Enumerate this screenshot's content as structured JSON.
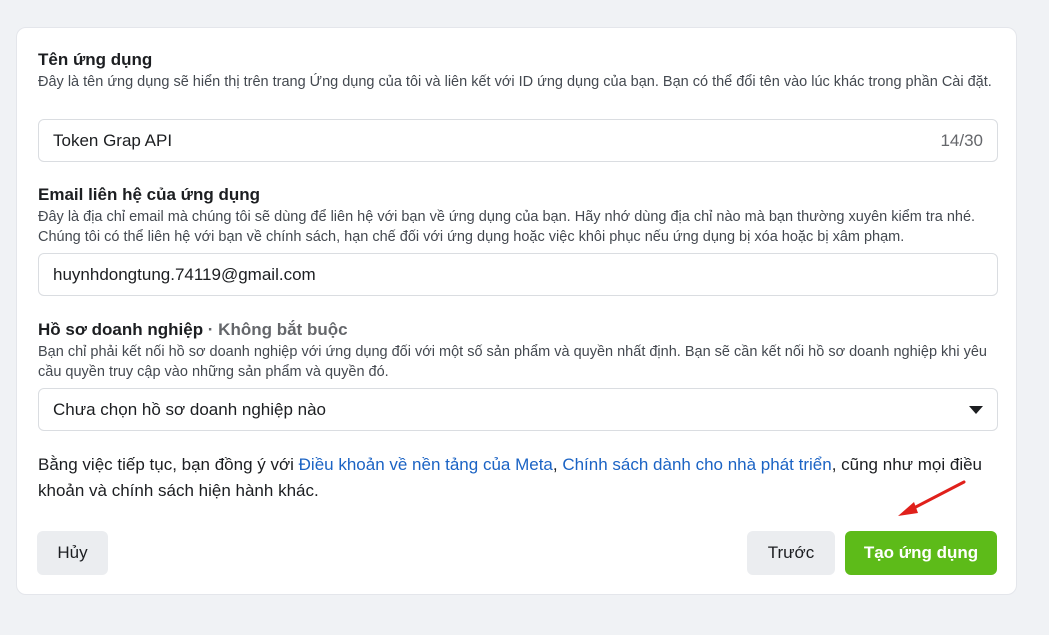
{
  "app_name": {
    "label": "Tên ứng dụng",
    "description": "Đây là tên ứng dụng sẽ hiển thị trên trang Ứng dụng của tôi và liên kết với ID ứng dụng của bạn. Bạn có thể đổi tên vào lúc khác trong phần Cài đặt.",
    "value": "Token Grap API",
    "counter": "14/30"
  },
  "contact_email": {
    "label": "Email liên hệ của ứng dụng",
    "description": "Đây là địa chỉ email mà chúng tôi sẽ dùng để liên hệ với bạn về ứng dụng của bạn. Hãy nhớ dùng địa chỉ nào mà bạn thường xuyên kiểm tra nhé. Chúng tôi có thể liên hệ với bạn về chính sách, hạn chế đối với ứng dụng hoặc việc khôi phục nếu ứng dụng bị xóa hoặc bị xâm phạm.",
    "value": "huynhdongtung.74119@gmail.com"
  },
  "business_profile": {
    "label": "Hồ sơ doanh nghiệp",
    "optional": " · Không bắt buộc",
    "description": "Bạn chỉ phải kết nối hồ sơ doanh nghiệp với ứng dụng đối với một số sản phẩm và quyền nhất định. Bạn sẽ cần kết nối hồ sơ doanh nghiệp khi yêu cầu quyền truy cập vào những sản phẩm và quyền đó.",
    "selected": "Chưa chọn hồ sơ doanh nghiệp nào"
  },
  "consent": {
    "prefix": "Bằng việc tiếp tục, bạn đồng ý với ",
    "terms_link": "Điều khoản về nền tảng của Meta",
    "separator": ", ",
    "policy_link": "Chính sách dành cho nhà phát triển",
    "suffix": ", cũng như mọi điều khoản và chính sách hiện hành khác."
  },
  "buttons": {
    "cancel": "Hủy",
    "previous": "Trước",
    "create": "Tạo ứng dụng"
  },
  "colors": {
    "primary_button": "#5dbb19",
    "link": "#1b63c4",
    "annotation_arrow": "#e0201b"
  },
  "icons": {
    "dropdown": "caret-down-icon",
    "annotation": "red-arrow-icon"
  }
}
